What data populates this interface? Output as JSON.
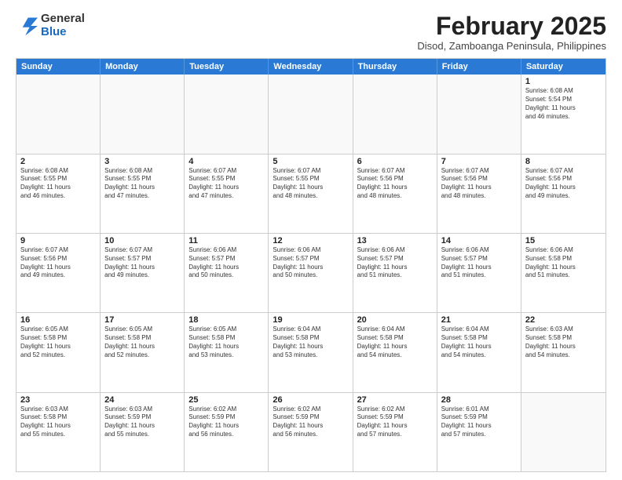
{
  "logo": {
    "general": "General",
    "blue": "Blue"
  },
  "title": "February 2025",
  "subtitle": "Disod, Zamboanga Peninsula, Philippines",
  "weekdays": [
    "Sunday",
    "Monday",
    "Tuesday",
    "Wednesday",
    "Thursday",
    "Friday",
    "Saturday"
  ],
  "rows": [
    [
      {
        "day": "",
        "info": "",
        "empty": true
      },
      {
        "day": "",
        "info": "",
        "empty": true
      },
      {
        "day": "",
        "info": "",
        "empty": true
      },
      {
        "day": "",
        "info": "",
        "empty": true
      },
      {
        "day": "",
        "info": "",
        "empty": true
      },
      {
        "day": "",
        "info": "",
        "empty": true
      },
      {
        "day": "1",
        "info": "Sunrise: 6:08 AM\nSunset: 5:54 PM\nDaylight: 11 hours\nand 46 minutes."
      }
    ],
    [
      {
        "day": "2",
        "info": "Sunrise: 6:08 AM\nSunset: 5:55 PM\nDaylight: 11 hours\nand 46 minutes."
      },
      {
        "day": "3",
        "info": "Sunrise: 6:08 AM\nSunset: 5:55 PM\nDaylight: 11 hours\nand 47 minutes."
      },
      {
        "day": "4",
        "info": "Sunrise: 6:07 AM\nSunset: 5:55 PM\nDaylight: 11 hours\nand 47 minutes."
      },
      {
        "day": "5",
        "info": "Sunrise: 6:07 AM\nSunset: 5:55 PM\nDaylight: 11 hours\nand 48 minutes."
      },
      {
        "day": "6",
        "info": "Sunrise: 6:07 AM\nSunset: 5:56 PM\nDaylight: 11 hours\nand 48 minutes."
      },
      {
        "day": "7",
        "info": "Sunrise: 6:07 AM\nSunset: 5:56 PM\nDaylight: 11 hours\nand 48 minutes."
      },
      {
        "day": "8",
        "info": "Sunrise: 6:07 AM\nSunset: 5:56 PM\nDaylight: 11 hours\nand 49 minutes."
      }
    ],
    [
      {
        "day": "9",
        "info": "Sunrise: 6:07 AM\nSunset: 5:56 PM\nDaylight: 11 hours\nand 49 minutes."
      },
      {
        "day": "10",
        "info": "Sunrise: 6:07 AM\nSunset: 5:57 PM\nDaylight: 11 hours\nand 49 minutes."
      },
      {
        "day": "11",
        "info": "Sunrise: 6:06 AM\nSunset: 5:57 PM\nDaylight: 11 hours\nand 50 minutes."
      },
      {
        "day": "12",
        "info": "Sunrise: 6:06 AM\nSunset: 5:57 PM\nDaylight: 11 hours\nand 50 minutes."
      },
      {
        "day": "13",
        "info": "Sunrise: 6:06 AM\nSunset: 5:57 PM\nDaylight: 11 hours\nand 51 minutes."
      },
      {
        "day": "14",
        "info": "Sunrise: 6:06 AM\nSunset: 5:57 PM\nDaylight: 11 hours\nand 51 minutes."
      },
      {
        "day": "15",
        "info": "Sunrise: 6:06 AM\nSunset: 5:58 PM\nDaylight: 11 hours\nand 51 minutes."
      }
    ],
    [
      {
        "day": "16",
        "info": "Sunrise: 6:05 AM\nSunset: 5:58 PM\nDaylight: 11 hours\nand 52 minutes."
      },
      {
        "day": "17",
        "info": "Sunrise: 6:05 AM\nSunset: 5:58 PM\nDaylight: 11 hours\nand 52 minutes."
      },
      {
        "day": "18",
        "info": "Sunrise: 6:05 AM\nSunset: 5:58 PM\nDaylight: 11 hours\nand 53 minutes."
      },
      {
        "day": "19",
        "info": "Sunrise: 6:04 AM\nSunset: 5:58 PM\nDaylight: 11 hours\nand 53 minutes."
      },
      {
        "day": "20",
        "info": "Sunrise: 6:04 AM\nSunset: 5:58 PM\nDaylight: 11 hours\nand 54 minutes."
      },
      {
        "day": "21",
        "info": "Sunrise: 6:04 AM\nSunset: 5:58 PM\nDaylight: 11 hours\nand 54 minutes."
      },
      {
        "day": "22",
        "info": "Sunrise: 6:03 AM\nSunset: 5:58 PM\nDaylight: 11 hours\nand 54 minutes."
      }
    ],
    [
      {
        "day": "23",
        "info": "Sunrise: 6:03 AM\nSunset: 5:58 PM\nDaylight: 11 hours\nand 55 minutes."
      },
      {
        "day": "24",
        "info": "Sunrise: 6:03 AM\nSunset: 5:59 PM\nDaylight: 11 hours\nand 55 minutes."
      },
      {
        "day": "25",
        "info": "Sunrise: 6:02 AM\nSunset: 5:59 PM\nDaylight: 11 hours\nand 56 minutes."
      },
      {
        "day": "26",
        "info": "Sunrise: 6:02 AM\nSunset: 5:59 PM\nDaylight: 11 hours\nand 56 minutes."
      },
      {
        "day": "27",
        "info": "Sunrise: 6:02 AM\nSunset: 5:59 PM\nDaylight: 11 hours\nand 57 minutes."
      },
      {
        "day": "28",
        "info": "Sunrise: 6:01 AM\nSunset: 5:59 PM\nDaylight: 11 hours\nand 57 minutes."
      },
      {
        "day": "",
        "info": "",
        "empty": true
      }
    ]
  ]
}
